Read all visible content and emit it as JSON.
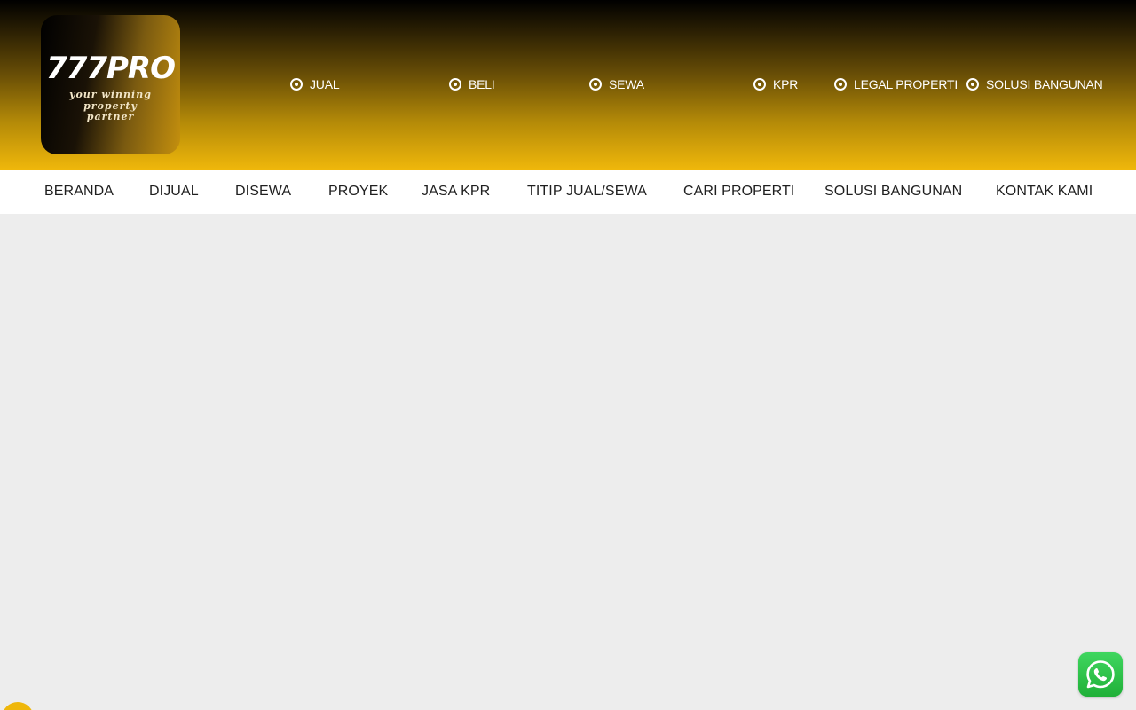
{
  "logo": {
    "main": "777PRO",
    "tagline_lines": [
      "your winning",
      "property",
      "partner"
    ]
  },
  "quick_links": [
    {
      "label": "JUAL"
    },
    {
      "label": "BELI"
    },
    {
      "label": "SEWA"
    },
    {
      "label": "KPR"
    },
    {
      "label": "LEGAL PROPERTI"
    },
    {
      "label": "SOLUSI BANGUNAN"
    }
  ],
  "nav": [
    {
      "label": "BERANDA"
    },
    {
      "label": "DIJUAL"
    },
    {
      "label": "DISEWA"
    },
    {
      "label": "PROYEK"
    },
    {
      "label": "JASA KPR"
    },
    {
      "label": "TITIP JUAL/SEWA"
    },
    {
      "label": "CARI PROPERTI"
    },
    {
      "label": "SOLUSI BANGUNAN"
    },
    {
      "label": "KONTAK KAMI"
    }
  ],
  "colors": {
    "accent": "#efb70b",
    "nav_bg": "#ffffff",
    "page_bg": "#ededed",
    "whatsapp": "#25d366"
  },
  "icons": {
    "quick_link_icon": "radio-dot-icon",
    "floating_chat": "whatsapp-icon",
    "back_to_top": "scroll-top-icon"
  }
}
